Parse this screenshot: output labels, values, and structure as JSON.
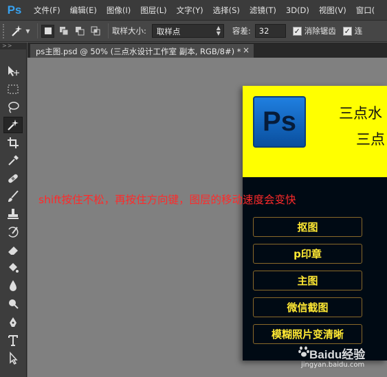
{
  "app": {
    "logo": "Ps"
  },
  "menu": [
    "文件(F)",
    "编辑(E)",
    "图像(I)",
    "图层(L)",
    "文字(Y)",
    "选择(S)",
    "滤镜(T)",
    "3D(D)",
    "视图(V)",
    "窗口("
  ],
  "options": {
    "sample_size_label": "取样大小:",
    "sample_size_value": "取样点",
    "tolerance_label": "容差:",
    "tolerance_value": "32",
    "antialias_label": "消除锯齿",
    "contiguous_label": "连"
  },
  "toolbox": {
    "header": ">>"
  },
  "document": {
    "tab_title": "ps主图.psd @ 50% (三点水设计工作室 副本, RGB/8#) *",
    "close_glyph": "×"
  },
  "canvas": {
    "ps_tile_text": "Ps",
    "title_line1": "三点水",
    "title_line2": "三点",
    "buttons": [
      "抠图",
      "p印章",
      "主图",
      "微信截图",
      "模糊照片变清晰"
    ],
    "annotation": "shift按住不松，再按住方向键，图层的移动速度会变快"
  },
  "watermark": {
    "main": "Baidu经验",
    "sub": "jingyan.baidu.com"
  },
  "colors": {
    "annotation": "#ff2a2a",
    "doc_header": "#ffff00",
    "doc_button_text": "#ffe833",
    "canvas_bg": "#808080"
  }
}
